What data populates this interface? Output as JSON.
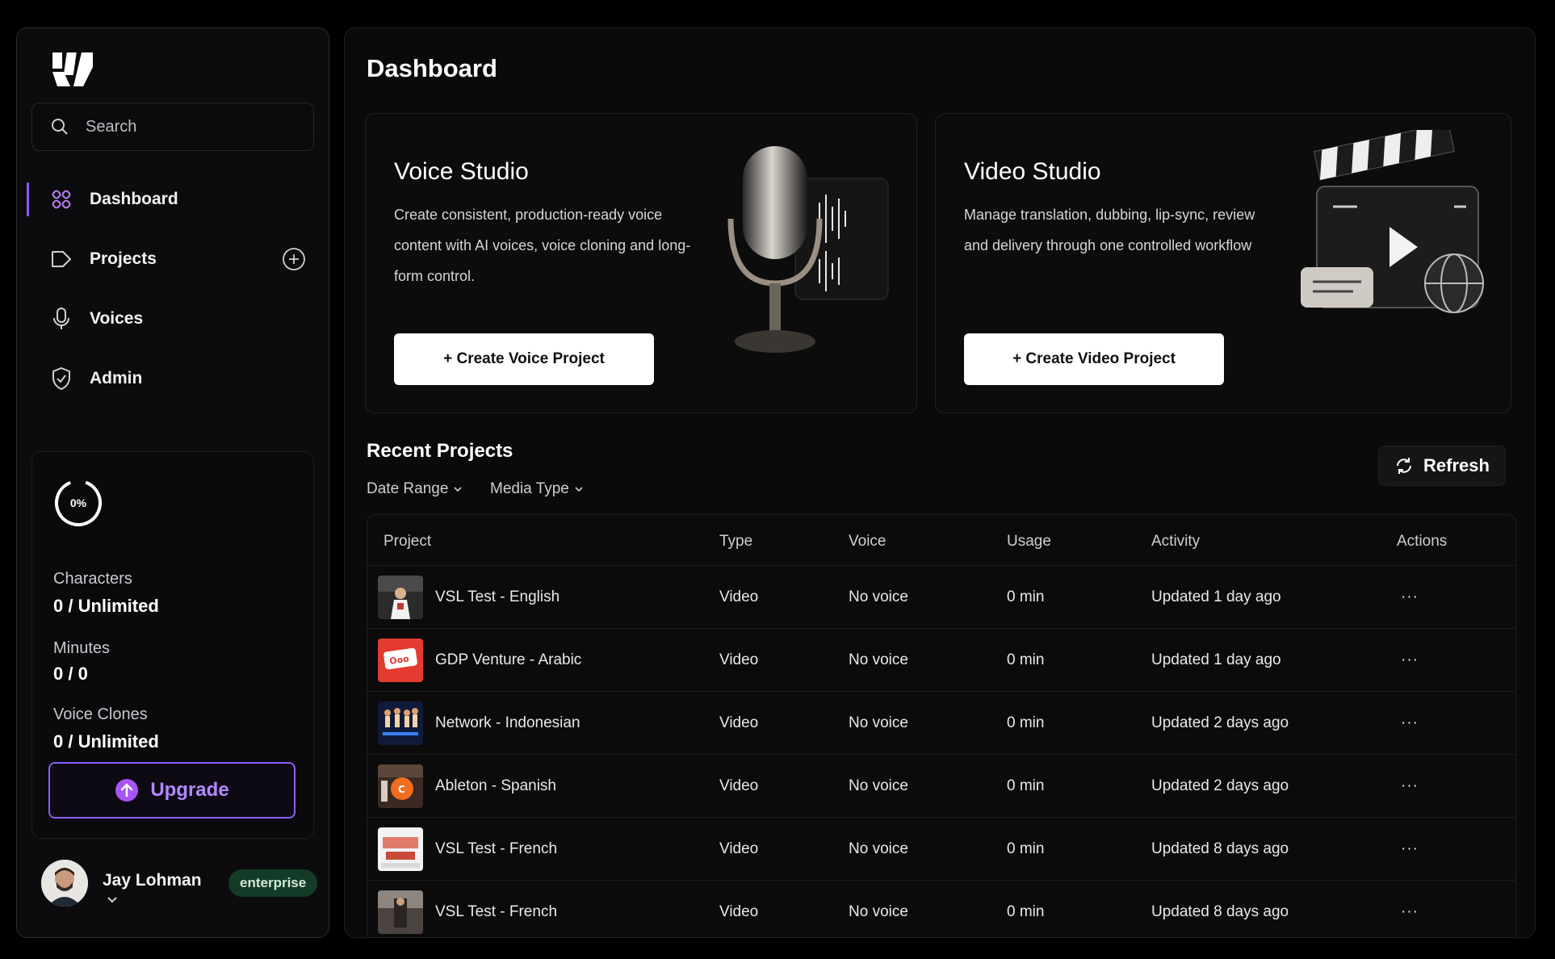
{
  "sidebar": {
    "search_placeholder": "Search",
    "items": [
      {
        "label": "Dashboard",
        "icon": "dashboard-icon",
        "active": true
      },
      {
        "label": "Projects",
        "icon": "projects-icon",
        "active": false
      },
      {
        "label": "Voices",
        "icon": "microphone-icon",
        "active": false
      },
      {
        "label": "Admin",
        "icon": "shield-icon",
        "active": false
      }
    ],
    "usage": {
      "percent_label": "0%",
      "percent_value": 0,
      "characters_label": "Characters",
      "characters_value": "0 / Unlimited",
      "minutes_label": "Minutes",
      "minutes_value": "0 / 0",
      "clones_label": "Voice Clones",
      "clones_value": "0 / Unlimited"
    },
    "upgrade_label": "Upgrade",
    "user": {
      "name": "Jay Lohman",
      "plan": "enterprise"
    }
  },
  "main": {
    "title": "Dashboard",
    "voice_studio": {
      "title": "Voice Studio",
      "description": "Create consistent, production-ready voice content with AI voices, voice cloning and long-form control.",
      "cta": "+ Create Voice Project"
    },
    "video_studio": {
      "title": "Video Studio",
      "description": "Manage translation, dubbing, lip-sync, review and delivery through one controlled workflow",
      "cta": "+ Create Video Project"
    },
    "recent": {
      "title": "Recent Projects",
      "filters": [
        "Date Range",
        "Media Type"
      ],
      "refresh_label": "Refresh",
      "columns": [
        "Project",
        "Type",
        "Voice",
        "Usage",
        "Activity",
        "Actions"
      ],
      "rows": [
        {
          "project": "VSL Test - English",
          "type": "Video",
          "voice": "No voice",
          "usage": "0 min",
          "activity": "Updated 1 day ago",
          "actions": "···"
        },
        {
          "project": "GDP Venture - Arabic",
          "type": "Video",
          "voice": "No voice",
          "usage": "0 min",
          "activity": "Updated 1 day ago",
          "actions": "···"
        },
        {
          "project": "Network - Indonesian",
          "type": "Video",
          "voice": "No voice",
          "usage": "0 min",
          "activity": "Updated 2 days ago",
          "actions": "···"
        },
        {
          "project": "Ableton - Spanish",
          "type": "Video",
          "voice": "No voice",
          "usage": "0 min",
          "activity": "Updated 2 days ago",
          "actions": "···"
        },
        {
          "project": "VSL Test - French",
          "type": "Video",
          "voice": "No voice",
          "usage": "0 min",
          "activity": "Updated 8 days ago",
          "actions": "···"
        },
        {
          "project": "VSL Test - French",
          "type": "Video",
          "voice": "No voice",
          "usage": "0 min",
          "activity": "Updated 8 days ago",
          "actions": "···"
        }
      ]
    }
  },
  "colors": {
    "accent": "#8b5cf6",
    "badge_bg": "#133b27"
  }
}
